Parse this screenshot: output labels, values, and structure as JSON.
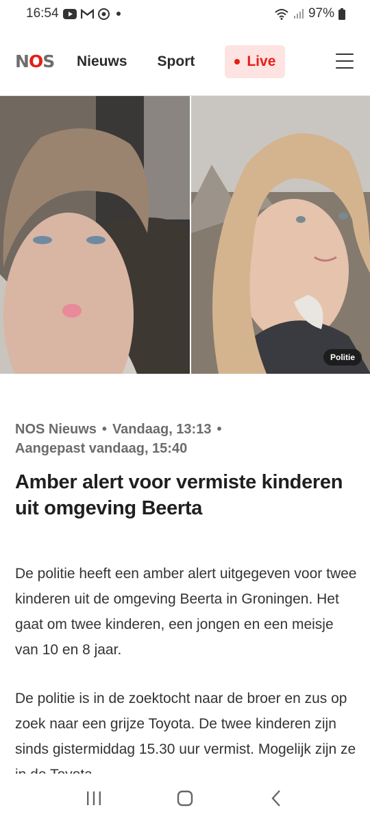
{
  "status_bar": {
    "time": "16:54",
    "battery": "97%",
    "icons_left": [
      "youtube-icon",
      "gmail-icon",
      "chrome-icon",
      "dot-icon"
    ],
    "icons_right": [
      "wifi-icon",
      "signal-icon",
      "battery-icon"
    ]
  },
  "header": {
    "logo": {
      "n": "N",
      "o": "O",
      "s": "S"
    },
    "nav": [
      {
        "label": "Nieuws"
      },
      {
        "label": "Sport"
      }
    ],
    "live_label": "Live",
    "colors": {
      "accent": "#e61e14",
      "live_bg": "#fde3e1"
    }
  },
  "hero": {
    "credit": "Politie"
  },
  "article": {
    "source": "NOS Nieuws",
    "published": "Vandaag, 13:13",
    "updated": "Aangepast vandaag, 15:40",
    "title": "Amber alert voor vermiste kinderen uit omgeving Beerta",
    "paragraphs": [
      "De politie heeft een amber alert uitgegeven voor twee kinderen uit de omgeving Beerta in Groningen. Het gaat om twee kinderen, een jongen en een meisje van 10 en 8 jaar.",
      "De politie is in de zoektocht naar de broer en zus op zoek naar een grijze Toyota. De twee kinderen zijn sinds gistermiddag 15.30 uur vermist. Mogelijk zijn ze in de Toyota"
    ]
  }
}
